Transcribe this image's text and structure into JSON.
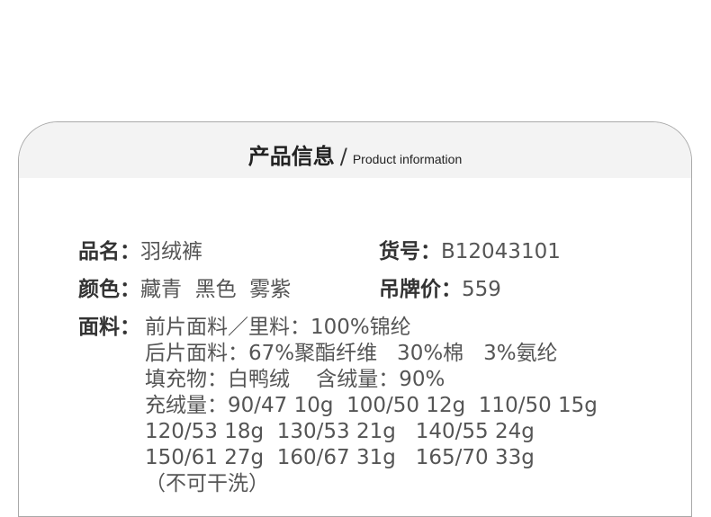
{
  "header": {
    "title_cn": "产品信息",
    "separator": "/",
    "title_en": "Product information"
  },
  "info": {
    "name_label": "品名：",
    "name_value": "羽绒裤",
    "sku_label": "货号：",
    "sku_value": "B12043101",
    "color_label": "颜色：",
    "color_value": "藏青  黑色  雾紫",
    "price_label": "吊牌价：",
    "price_value": "559",
    "fabric_label": "面料：",
    "fabric_lines": [
      "前片面料／里料：100%锦纶",
      "后片面料：67%聚酯纤维   30%棉   3%氨纶",
      "填充物：白鸭绒    含绒量：90%",
      "充绒量：90/47 10g  100/50 12g  110/50 15g",
      "120/53 18g  130/53 21g   140/55 24g",
      "150/61 27g  160/67 31g   165/70 33g",
      "（不可干洗）"
    ]
  },
  "colors": {
    "card_border": "#a9a9a9",
    "header_bg": "#f3f3f3",
    "label_text": "#333333",
    "value_text": "#555555"
  }
}
